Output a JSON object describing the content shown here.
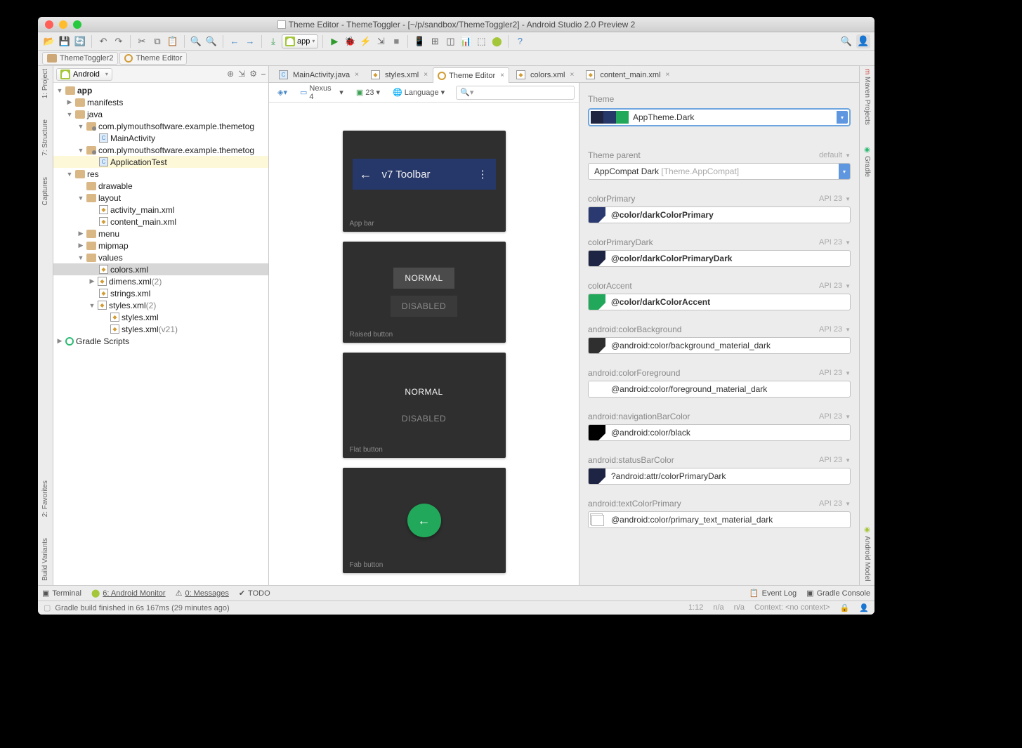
{
  "title": "Theme Editor - ThemeToggler - [~/p/sandbox/ThemeToggler2] - Android Studio 2.0 Preview 2",
  "breadcrumbs": {
    "a": "ThemeToggler2",
    "b": "Theme Editor"
  },
  "module": "app",
  "projectView": "Android",
  "leftTabs": {
    "project": "1: Project",
    "structure": "7: Structure",
    "captures": "Captures",
    "favorites": "2: Favorites",
    "build": "Build Variants"
  },
  "rightTabs": {
    "maven": "Maven Projects",
    "gradle": "Gradle",
    "android": "Android Model"
  },
  "tree": {
    "app": "app",
    "manifests": "manifests",
    "java": "java",
    "pkg1": "com.plymouthsoftware.example.themetog",
    "mainActivity": "MainActivity",
    "pkg2": "com.plymouthsoftware.example.themetog",
    "appTest": "ApplicationTest",
    "res": "res",
    "drawable": "drawable",
    "layout": "layout",
    "activity_main": "activity_main.xml",
    "content_main": "content_main.xml",
    "menu": "menu",
    "mipmap": "mipmap",
    "values": "values",
    "colors": "colors.xml",
    "dimens": "dimens.xml",
    "dimens_n": "(2)",
    "strings": "strings.xml",
    "styles": "styles.xml",
    "styles_n": "(2)",
    "styles1": "styles.xml",
    "styles2": "styles.xml",
    "styles2_n": "(v21)",
    "gradle": "Gradle Scripts"
  },
  "editorTabs": {
    "main": "MainActivity.java",
    "styles": "styles.xml",
    "theme": "Theme Editor",
    "colors": "colors.xml",
    "content": "content_main.xml"
  },
  "previewToolbar": {
    "device": "Nexus 4",
    "api": "23",
    "lang": "Language",
    "search": ""
  },
  "preview": {
    "appbar": {
      "title": "v7 Toolbar",
      "label": "App bar"
    },
    "raised": {
      "normal": "NORMAL",
      "disabled": "DISABLED",
      "label": "Raised button"
    },
    "flat": {
      "normal": "NORMAL",
      "disabled": "DISABLED",
      "label": "Flat button"
    },
    "fab": {
      "label": "Fab button"
    }
  },
  "themePanel": {
    "themeLabel": "Theme",
    "themeName": "AppTheme.Dark",
    "swatches": [
      "#1f2540",
      "#26386a",
      "#22a85a"
    ],
    "parentLabel": "Theme parent",
    "parentDefault": "default",
    "parentValue": "AppCompat Dark",
    "parentValueDim": "[Theme.AppCompat]"
  },
  "attrs": [
    {
      "name": "colorPrimary",
      "api": "API 23",
      "value": "@color/darkColorPrimary",
      "color": "#2a3970",
      "bold": true,
      "tri": true
    },
    {
      "name": "colorPrimaryDark",
      "api": "API 23",
      "value": "@color/darkColorPrimaryDark",
      "color": "#1e2443",
      "bold": true,
      "tri": true
    },
    {
      "name": "colorAccent",
      "api": "API 23",
      "value": "@color/darkColorAccent",
      "color": "#22a85a",
      "bold": true,
      "tri": true
    },
    {
      "name": "android:colorBackground",
      "api": "API 23",
      "value": "@android:color/background_material_dark",
      "color": "#2f2f2f",
      "bold": false,
      "tri": true
    },
    {
      "name": "android:colorForeground",
      "api": "API 23",
      "value": "@android:color/foreground_material_dark",
      "color": "#ffffff",
      "bold": false,
      "tri": true
    },
    {
      "name": "android:navigationBarColor",
      "api": "API 23",
      "value": "@android:color/black",
      "color": "#000000",
      "bold": false,
      "tri": true
    },
    {
      "name": "android:statusBarColor",
      "api": "API 23",
      "value": "?android:attr/colorPrimaryDark",
      "color": "#1e2443",
      "bold": false,
      "tri": true
    },
    {
      "name": "android:textColorPrimary",
      "api": "API 23",
      "value": "@android:color/primary_text_material_dark",
      "color": "stack",
      "bold": false,
      "tri": false
    }
  ],
  "bottom": {
    "terminal": "Terminal",
    "monitor": "6: Android Monitor",
    "messages": "0: Messages",
    "todo": "TODO",
    "eventlog": "Event Log",
    "gconsole": "Gradle Console"
  },
  "status": {
    "msg": "Gradle build finished in 6s 167ms (29 minutes ago)",
    "pos": "1:12",
    "na1": "n/a",
    "na2": "n/a",
    "ctx": "Context: <no context>"
  }
}
